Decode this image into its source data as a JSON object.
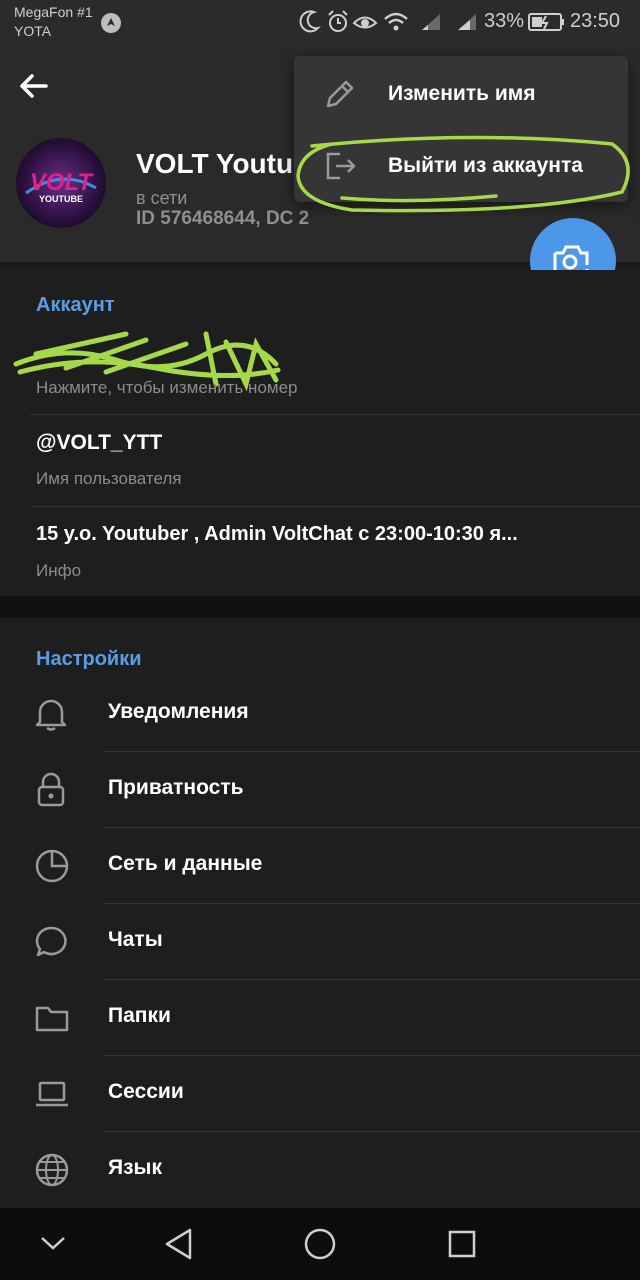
{
  "status_bar": {
    "carrier_primary": "MegaFon #1",
    "carrier_secondary": "YOTA",
    "battery_percent": "33%",
    "time": "23:50"
  },
  "profile": {
    "name": "VOLT Youtu",
    "status": "в сети",
    "id_line": "ID 576468644, DC 2",
    "avatar_text_main": "VOLT",
    "avatar_text_sub": "YOUTUBE"
  },
  "menu": {
    "items": [
      {
        "label": "Изменить имя",
        "icon": "pencil-icon"
      },
      {
        "label": "Выйти из аккаунта",
        "icon": "logout-icon"
      }
    ]
  },
  "account": {
    "title": "Аккаунт",
    "phone_hint": "Нажмите, чтобы изменить номер",
    "username": "@VOLT_YTT",
    "username_label": "Имя пользователя",
    "bio": "15 y.o. Youtuber , Admin VoltChat с 23:00-10:30 я...",
    "bio_label": "Инфо"
  },
  "settings": {
    "title": "Настройки",
    "items": [
      {
        "label": "Уведомления",
        "icon": "bell-icon"
      },
      {
        "label": "Приватность",
        "icon": "lock-icon"
      },
      {
        "label": "Сеть и данные",
        "icon": "pie-chart-icon"
      },
      {
        "label": "Чаты",
        "icon": "chat-bubble-icon"
      },
      {
        "label": "Папки",
        "icon": "folder-icon"
      },
      {
        "label": "Сессии",
        "icon": "laptop-icon"
      },
      {
        "label": "Язык",
        "icon": "globe-icon"
      }
    ]
  },
  "colors": {
    "accent": "#4c97e8",
    "section_title": "#5b9de5",
    "highlight_scribble": "#a6d94a"
  }
}
